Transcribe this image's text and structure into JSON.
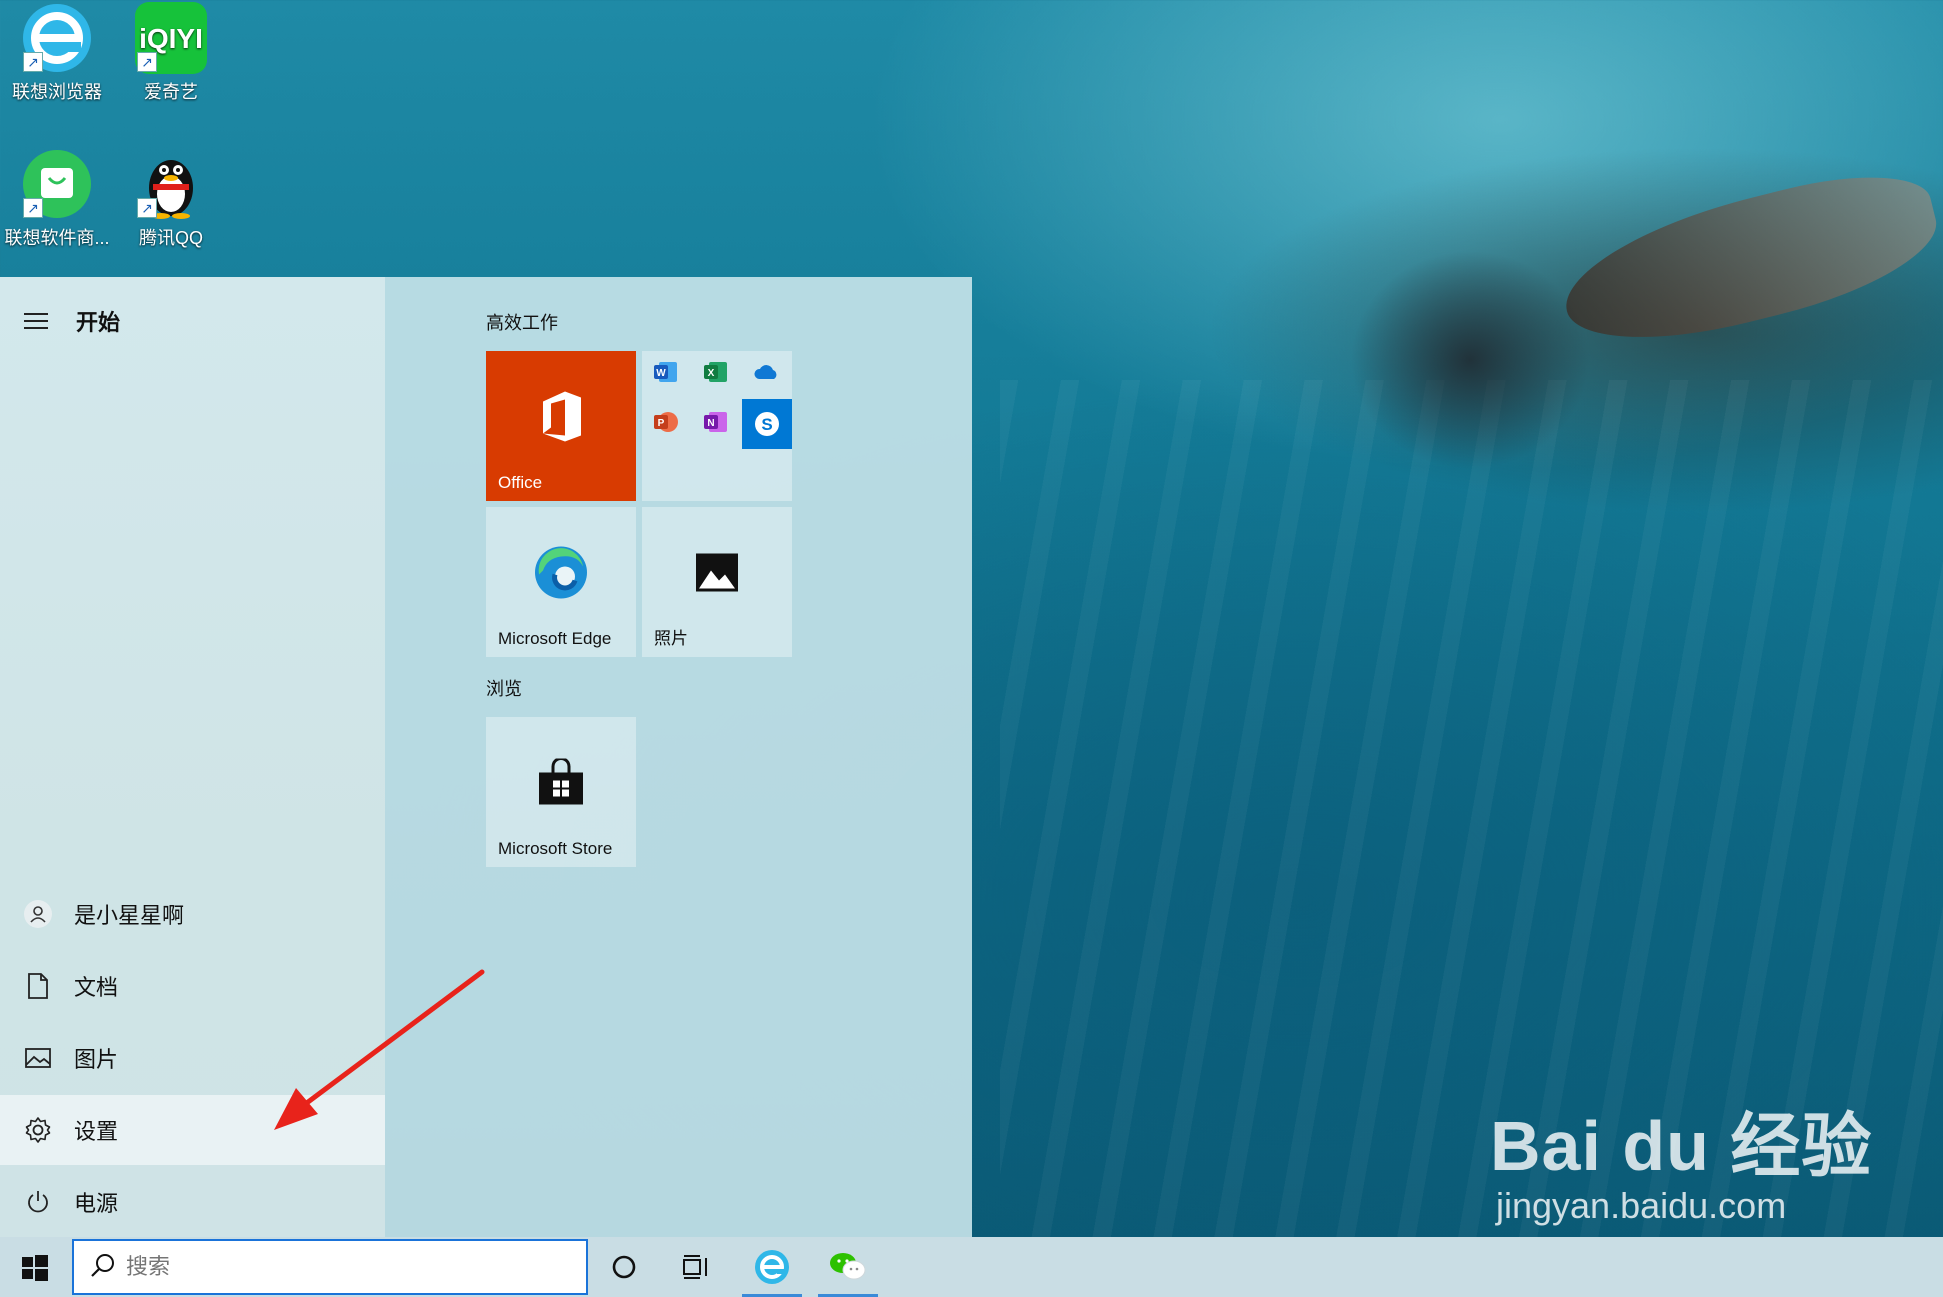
{
  "desktop": {
    "icons": [
      {
        "label": "联想浏览器",
        "icon": "lenovo-browser-icon"
      },
      {
        "label": "爱奇艺",
        "icon": "iqiyi-icon",
        "logo_text": "iQIYI"
      },
      {
        "label": "联想软件商...",
        "icon": "lenovo-store-icon"
      },
      {
        "label": "腾讯QQ",
        "icon": "qq-penguin-icon"
      }
    ]
  },
  "start_menu": {
    "title": "开始",
    "left_items": [
      {
        "label": "是小星星啊",
        "icon": "user-icon"
      },
      {
        "label": "文档",
        "icon": "document-icon"
      },
      {
        "label": "图片",
        "icon": "pictures-icon"
      },
      {
        "label": "设置",
        "icon": "gear-icon"
      },
      {
        "label": "电源",
        "icon": "power-icon"
      }
    ],
    "groups": [
      {
        "label": "高效工作"
      },
      {
        "label": "浏览"
      }
    ],
    "tiles": {
      "office": {
        "label": "Office",
        "color": "#d83b01"
      },
      "edge": {
        "label": "Microsoft Edge"
      },
      "photos": {
        "label": "照片"
      },
      "store": {
        "label": "Microsoft Store"
      }
    },
    "mini_apps": [
      {
        "icon": "word-icon",
        "letter": "W",
        "color": "#185abd"
      },
      {
        "icon": "excel-icon",
        "letter": "X",
        "color": "#107c41"
      },
      {
        "icon": "onedrive-icon",
        "letter": "",
        "color": "#0f78d4"
      },
      {
        "icon": "powerpoint-icon",
        "letter": "P",
        "color": "#c43e1c"
      },
      {
        "icon": "onenote-icon",
        "letter": "N",
        "color": "#7719aa"
      },
      {
        "icon": "skype-icon",
        "letter": "S",
        "color": "#0078d4"
      }
    ]
  },
  "taskbar": {
    "search_placeholder": "搜索",
    "buttons": [
      {
        "icon": "cortana-icon"
      },
      {
        "icon": "task-view-icon"
      },
      {
        "icon": "lenovo-browser-icon"
      },
      {
        "icon": "wechat-icon"
      }
    ]
  },
  "watermark": {
    "brand": "Bai du 经验",
    "site": "jingyan.baidu.com"
  },
  "colors": {
    "accent": "#1a73d9",
    "annotation_arrow": "#e8231b"
  }
}
